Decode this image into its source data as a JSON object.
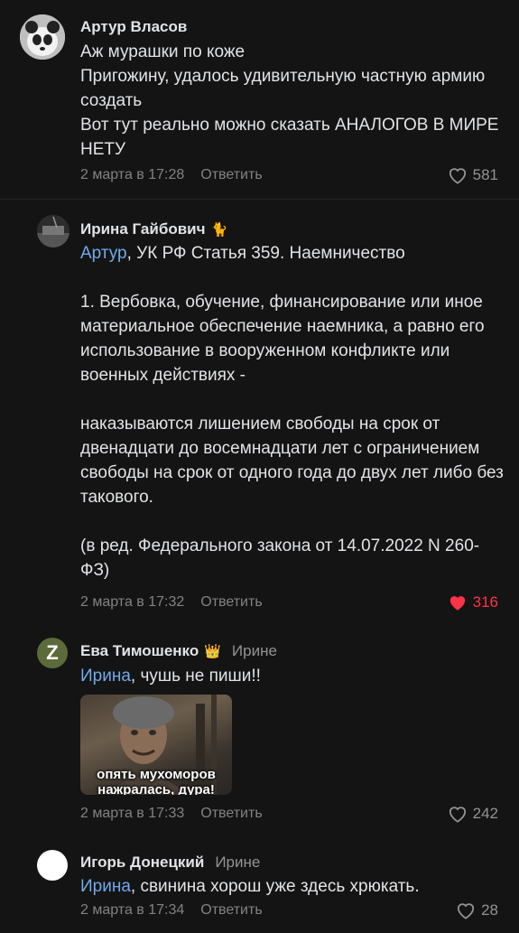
{
  "comments": [
    {
      "author": "Артур Власов",
      "lines": [
        "Аж мурашки по коже",
        "Пригожину, удалось удивительную частную армию создать",
        "Вот тут реально можно сказать АНАЛОГОВ В МИРЕ НЕТУ"
      ],
      "date": "2 марта в 17:28",
      "reply_label": "Ответить",
      "likes": "581",
      "liked": false
    },
    {
      "author": "Ирина Гайбович",
      "author_emoji": "🐈",
      "mention": "Артур",
      "first_line_rest": ", УК РФ Статья 359. Наемничество",
      "paragraph1": "1. Вербовка, обучение, финансирование или иное материальное обеспечение наемника, а равно его использование в вооруженном конфликте или военных действиях -",
      "paragraph2": "наказываются лишением свободы на срок от двенадцати до восемнадцати лет с ограничением свободы на срок от одного года до двух лет либо без такового.",
      "paragraph3": "(в ред. Федерального закона от 14.07.2022 N 260-ФЗ)",
      "date": "2 марта в 17:32",
      "reply_label": "Ответить",
      "likes": "316",
      "liked": true
    },
    {
      "author": "Ева Тимошенко",
      "author_emoji": "👑",
      "reply_to": "Ирине",
      "avatar_letter": "Z",
      "mention": "Ирина",
      "text_rest": ", чушь не пиши!!",
      "meme_line1": "опять мухоморов",
      "meme_line2": "нажралась, дура!",
      "date": "2 марта в 17:33",
      "reply_label": "Ответить",
      "likes": "242",
      "liked": false
    },
    {
      "author": "Игорь Донецкий",
      "reply_to": "Ирине",
      "mention": "Ирина",
      "text_rest": ", свинина хорош уже здесь хрюкать.",
      "date": "2 марта в 17:34",
      "reply_label": "Ответить",
      "likes": "28",
      "liked": false
    }
  ],
  "colors": {
    "background": "#141414",
    "link": "#71aaeb",
    "like_active": "#ff3347",
    "muted": "#828282"
  }
}
